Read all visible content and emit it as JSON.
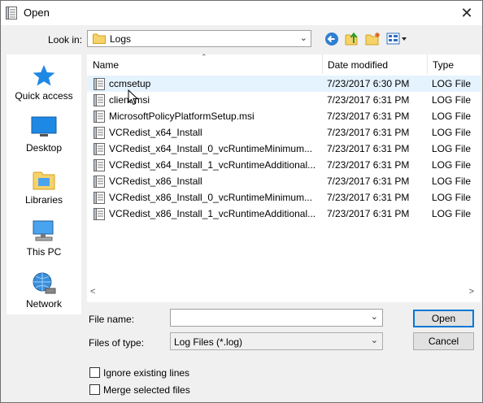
{
  "window": {
    "title": "Open",
    "close_glyph": "✕"
  },
  "look_in": {
    "label": "Look in:",
    "value": "Logs"
  },
  "toolbar": {
    "icons": [
      "back-arrow-icon",
      "up-folder-icon",
      "new-folder-icon",
      "view-menu-icon"
    ]
  },
  "places": [
    {
      "label": "Quick access",
      "icon": "star-icon"
    },
    {
      "label": "Desktop",
      "icon": "desktop-icon"
    },
    {
      "label": "Libraries",
      "icon": "libraries-icon"
    },
    {
      "label": "This PC",
      "icon": "computer-icon"
    },
    {
      "label": "Network",
      "icon": "network-icon"
    }
  ],
  "columns": [
    "Name",
    "Date modified",
    "Type"
  ],
  "files": [
    {
      "name": "ccmsetup",
      "date": "7/23/2017 6:30 PM",
      "type": "LOG File"
    },
    {
      "name": "client.msi",
      "date": "7/23/2017 6:31 PM",
      "type": "LOG File"
    },
    {
      "name": "MicrosoftPolicyPlatformSetup.msi",
      "date": "7/23/2017 6:31 PM",
      "type": "LOG File"
    },
    {
      "name": "VCRedist_x64_Install",
      "date": "7/23/2017 6:31 PM",
      "type": "LOG File"
    },
    {
      "name": "VCRedist_x64_Install_0_vcRuntimeMinimum...",
      "date": "7/23/2017 6:31 PM",
      "type": "LOG File"
    },
    {
      "name": "VCRedist_x64_Install_1_vcRuntimeAdditional...",
      "date": "7/23/2017 6:31 PM",
      "type": "LOG File"
    },
    {
      "name": "VCRedist_x86_Install",
      "date": "7/23/2017 6:31 PM",
      "type": "LOG File"
    },
    {
      "name": "VCRedist_x86_Install_0_vcRuntimeMinimum...",
      "date": "7/23/2017 6:31 PM",
      "type": "LOG File"
    },
    {
      "name": "VCRedist_x86_Install_1_vcRuntimeAdditional...",
      "date": "7/23/2017 6:31 PM",
      "type": "LOG File"
    }
  ],
  "file_name": {
    "label": "File name:",
    "value": ""
  },
  "file_type": {
    "label": "Files of type:",
    "value": "Log Files (*.log)"
  },
  "buttons": {
    "open": "Open",
    "cancel": "Cancel"
  },
  "options": [
    {
      "label": "Ignore existing lines",
      "checked": false
    },
    {
      "label": "Merge selected files",
      "checked": false
    }
  ]
}
